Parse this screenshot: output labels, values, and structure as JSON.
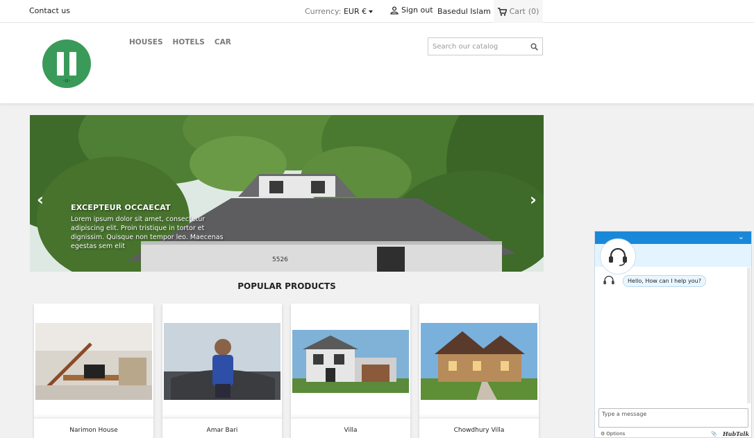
{
  "topbar": {
    "contact": "Contact us",
    "currency_label": "Currency:",
    "currency_value": "EUR €",
    "signout": "Sign out",
    "username": "Basedul Islam",
    "cart": "Cart",
    "cart_count": "(0)"
  },
  "nav": [
    "HOUSES",
    "HOTELS",
    "CAR"
  ],
  "search": {
    "placeholder": "Search our catalog"
  },
  "slider": {
    "title": "EXCEPTEUR OCCAECAT",
    "text": "Lorem ipsum dolor sit amet, consectetur adipiscing elit. Proin tristique in tortor et dignissim. Quisque non tempor leo. Maecenas egestas sem elit",
    "house_number": "5526"
  },
  "popular": {
    "title": "POPULAR PRODUCTS",
    "items": [
      {
        "name": "Narimon House"
      },
      {
        "name": "Amar Bari"
      },
      {
        "name": "Villa"
      },
      {
        "name": "Chowdhury Villa"
      }
    ]
  },
  "chat": {
    "greeting": "Hello, How can I help you?",
    "input_placeholder": "Type a message",
    "options": "Options",
    "brand": "HubTalk"
  },
  "colors": {
    "chat_header": "#1a88d8",
    "logo": "#3a9a5a"
  }
}
